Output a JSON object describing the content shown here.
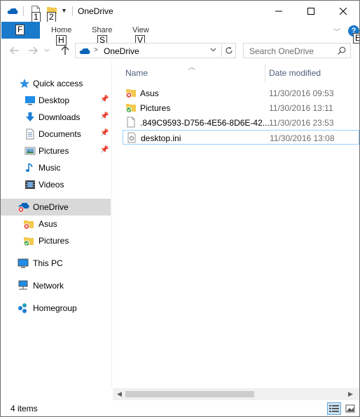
{
  "window": {
    "title": "OneDrive"
  },
  "quick_access": {
    "keytips": [
      "1",
      "2"
    ]
  },
  "ribbon": {
    "file_keytip": "F",
    "tabs": [
      {
        "label": "Home",
        "keytip": "H"
      },
      {
        "label": "Share",
        "keytip": "S"
      },
      {
        "label": "View",
        "keytip": "V"
      }
    ],
    "help_label": "?",
    "help_keytip": "E"
  },
  "address_bar": {
    "path": "OneDrive"
  },
  "search": {
    "placeholder": "Search OneDrive"
  },
  "nav_pane": {
    "items": [
      {
        "label": "Quick access",
        "icon": "star-icon"
      },
      {
        "label": "Desktop",
        "icon": "desktop-icon",
        "pinned": true
      },
      {
        "label": "Downloads",
        "icon": "download-icon",
        "pinned": true
      },
      {
        "label": "Documents",
        "icon": "documents-icon",
        "pinned": true
      },
      {
        "label": "Pictures",
        "icon": "pictures-icon",
        "pinned": true
      },
      {
        "label": "Music",
        "icon": "music-icon"
      },
      {
        "label": "Videos",
        "icon": "videos-icon"
      },
      {
        "label": "OneDrive",
        "icon": "onedrive-error-icon",
        "selected": true
      },
      {
        "label": "Asus",
        "icon": "folder-error-icon"
      },
      {
        "label": "Pictures",
        "icon": "folder-synced-icon"
      },
      {
        "label": "This PC",
        "icon": "computer-icon"
      },
      {
        "label": "Network",
        "icon": "network-icon"
      },
      {
        "label": "Homegroup",
        "icon": "homegroup-icon"
      }
    ]
  },
  "file_list": {
    "columns": [
      "Name",
      "Date modified"
    ],
    "rows": [
      {
        "name": "Asus",
        "date": "11/30/2016 09:53",
        "icon": "folder-error-icon"
      },
      {
        "name": "Pictures",
        "date": "11/30/2016 13:11",
        "icon": "folder-synced-icon"
      },
      {
        "name": ".849C9593-D756-4E56-8D6E-42...",
        "date": "11/30/2016 23:53",
        "icon": "file-icon"
      },
      {
        "name": "desktop.ini",
        "date": "11/30/2016 13:08",
        "icon": "settings-file-icon",
        "selected": true
      }
    ]
  },
  "status_bar": {
    "item_count": "4 items"
  },
  "colors": {
    "accent": "#1979ca",
    "selection": "#d9d9d9",
    "header_text": "#4c607a",
    "error": "#e0342a",
    "synced": "#3aa23a",
    "folder": "#f3c94e"
  }
}
